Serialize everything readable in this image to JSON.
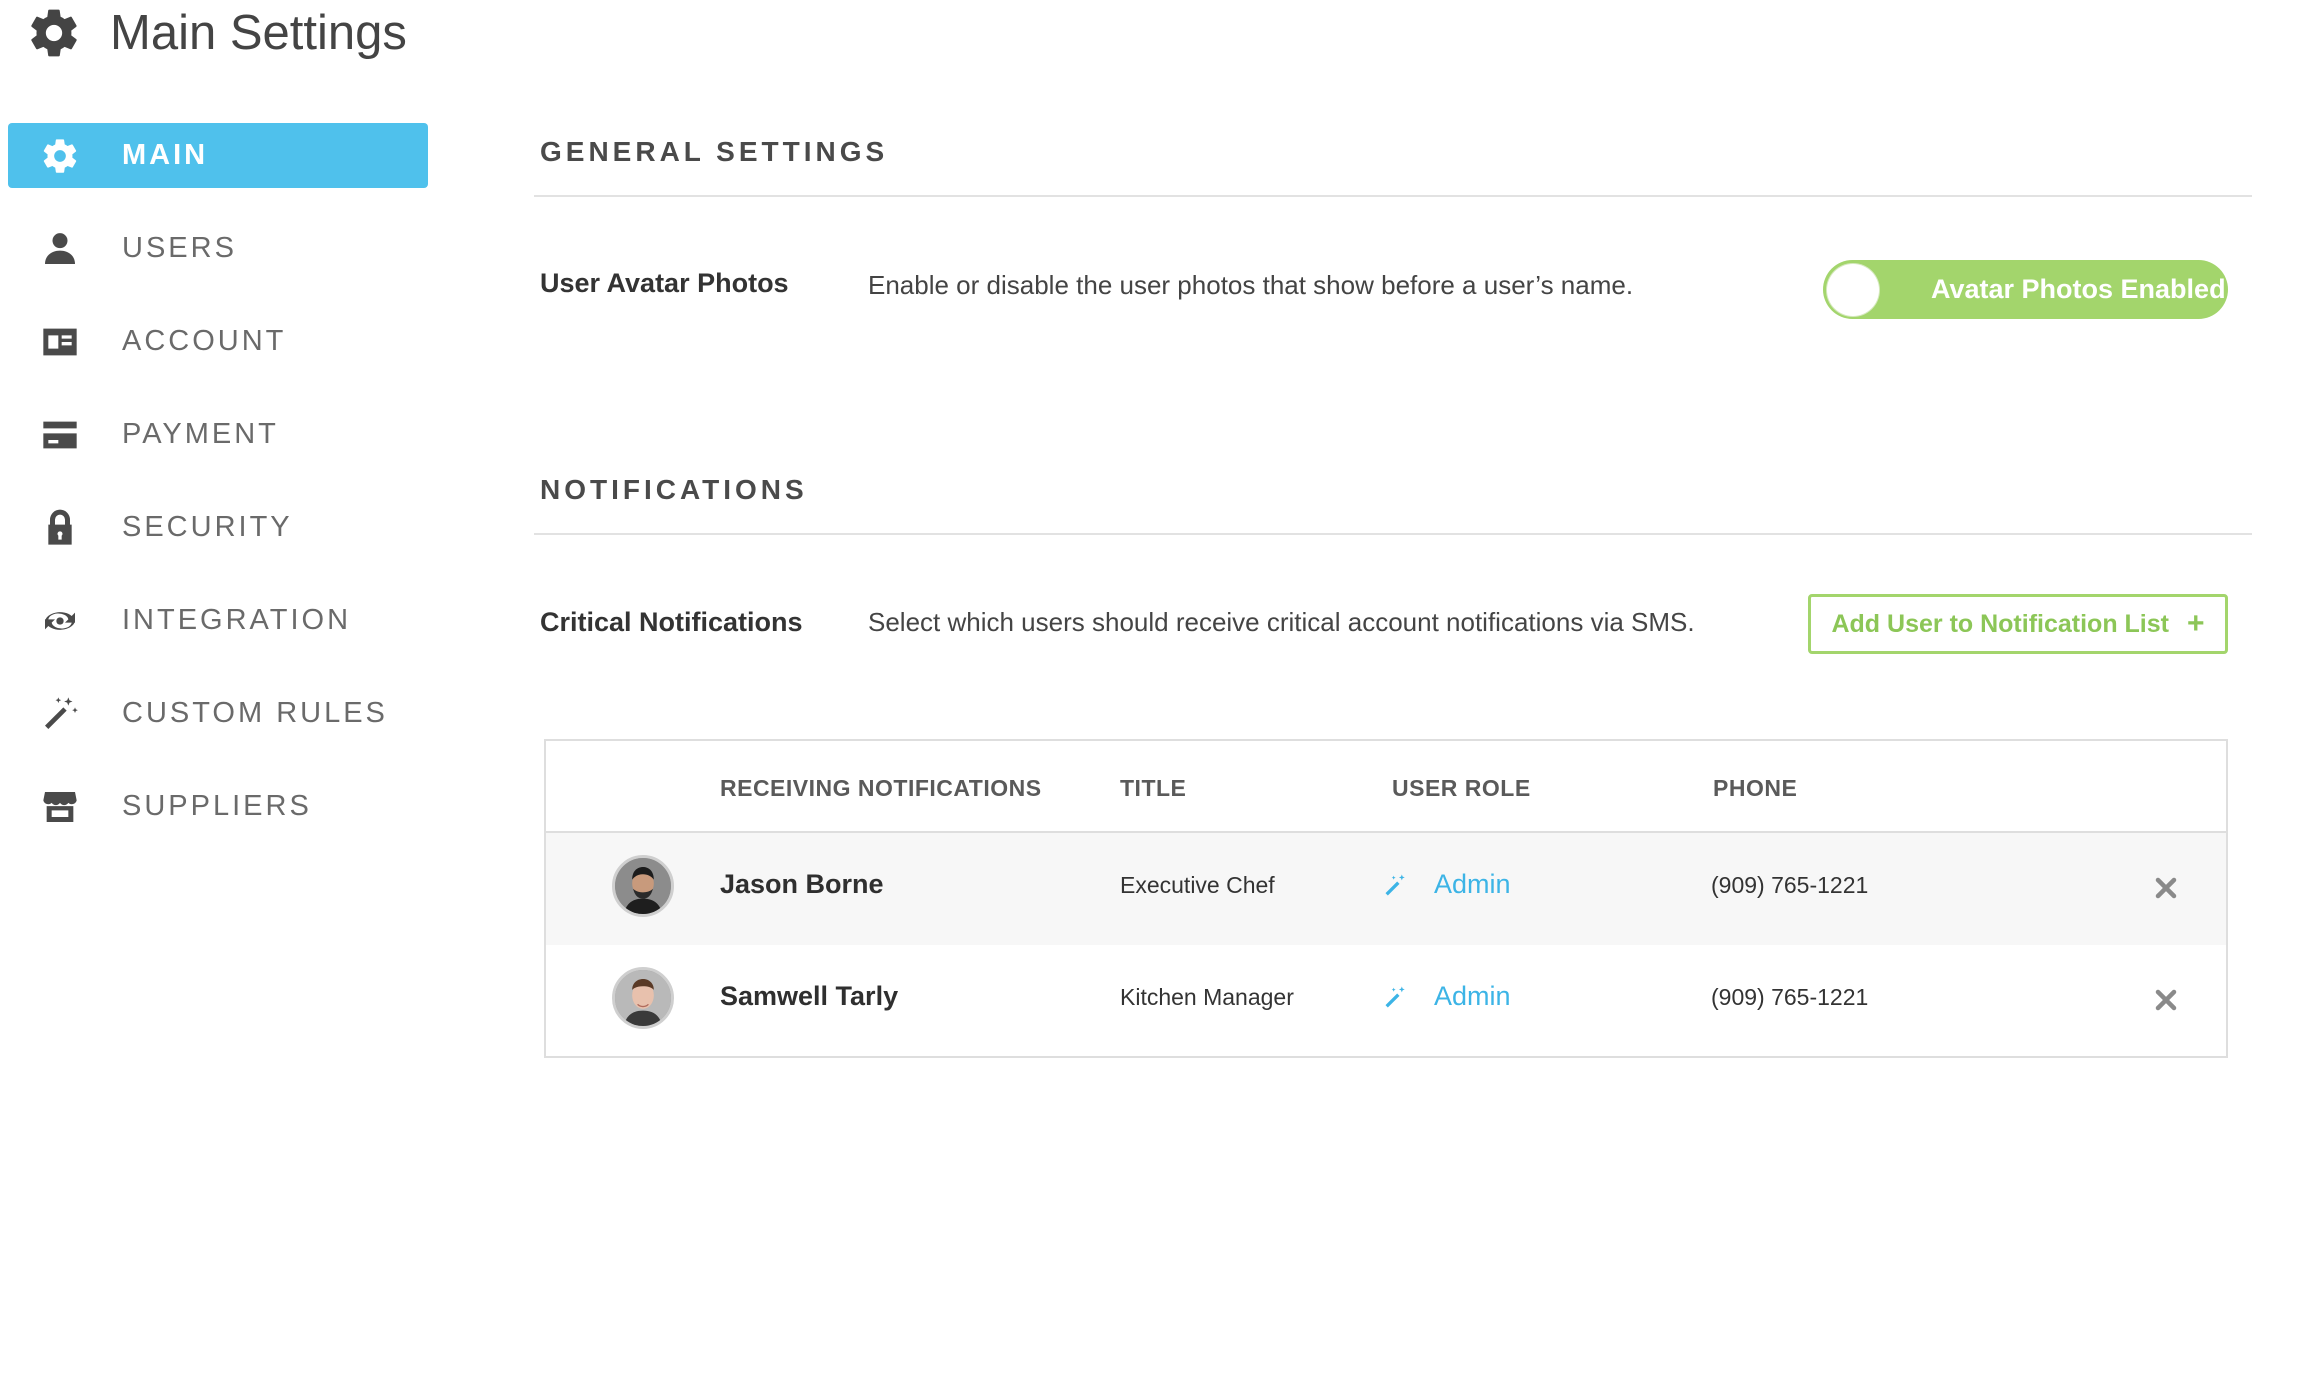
{
  "header": {
    "title": "Main Settings",
    "icon": "gear-icon"
  },
  "sidebar": {
    "items": [
      {
        "label": "MAIN",
        "icon": "gear-icon",
        "active": true
      },
      {
        "label": "USERS",
        "icon": "user-icon",
        "active": false
      },
      {
        "label": "ACCOUNT",
        "icon": "id-card-icon",
        "active": false
      },
      {
        "label": "PAYMENT",
        "icon": "credit-card-icon",
        "active": false
      },
      {
        "label": "SECURITY",
        "icon": "lock-icon",
        "active": false
      },
      {
        "label": "INTEGRATION",
        "icon": "integration-icon",
        "active": false
      },
      {
        "label": "CUSTOM RULES",
        "icon": "magic-wand-icon",
        "active": false
      },
      {
        "label": "SUPPLIERS",
        "icon": "storefront-icon",
        "active": false
      }
    ]
  },
  "general": {
    "title": "GENERAL SETTINGS",
    "avatar_label": "User Avatar Photos",
    "avatar_desc": "Enable or disable the user photos that show before a user’s name.",
    "toggle_label": "Avatar Photos Enabled",
    "toggle_on": true
  },
  "notifications": {
    "title": "NOTIFICATIONS",
    "critical_label": "Critical Notifications",
    "critical_desc": "Select which users should receive critical account notifications via SMS.",
    "add_button": "Add User to Notification List",
    "add_icon": "+",
    "columns": {
      "receiving": "RECEIVING NOTIFICATIONS",
      "title": "TITLE",
      "role": "USER ROLE",
      "phone": "PHONE"
    },
    "rows": [
      {
        "name": "Jason Borne",
        "title": "Executive Chef",
        "role": "Admin",
        "phone": "(909) 765-1221"
      },
      {
        "name": "Samwell Tarly",
        "title": "Kitchen Manager",
        "role": "Admin",
        "phone": "(909) 765-1221"
      }
    ]
  },
  "colors": {
    "accent": "#4fc1ec",
    "toggle": "#a3d56c",
    "add_button": "#8cc657",
    "role_link": "#3cb4e6"
  }
}
